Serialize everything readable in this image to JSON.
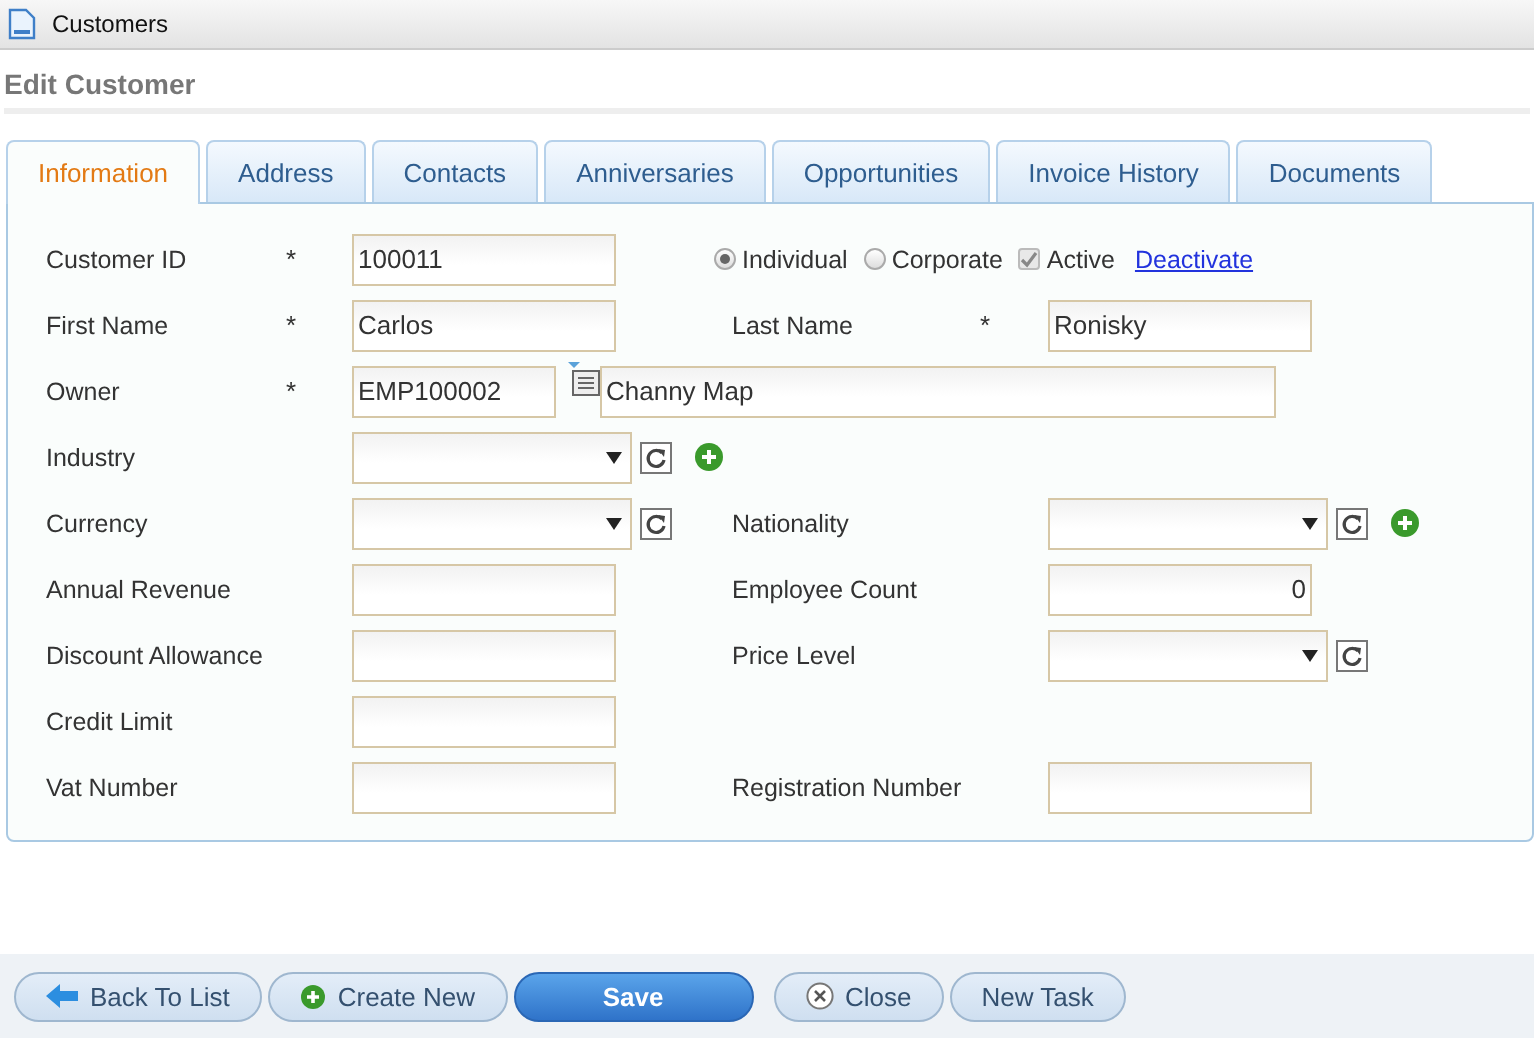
{
  "window": {
    "title": "Customers"
  },
  "heading": "Edit Customer",
  "tabs": [
    {
      "label": "Information",
      "selected": true
    },
    {
      "label": "Address",
      "selected": false
    },
    {
      "label": "Contacts",
      "selected": false
    },
    {
      "label": "Anniversaries",
      "selected": false
    },
    {
      "label": "Opportunities",
      "selected": false
    },
    {
      "label": "Invoice History",
      "selected": false
    },
    {
      "label": "Documents",
      "selected": false
    }
  ],
  "rows": [
    {
      "left": {
        "label": "Customer ID",
        "required_mark": "*",
        "kind": "text",
        "value": "100011"
      },
      "right": {
        "kind": "options",
        "radios": [
          {
            "label": "Individual",
            "selected": true
          },
          {
            "label": "Corporate",
            "selected": false
          }
        ],
        "checkbox": {
          "label": "Active",
          "checked": true,
          "disabled": true
        },
        "link": "Deactivate"
      }
    },
    {
      "left": {
        "label": "First Name",
        "required_mark": "*",
        "kind": "text",
        "value": "Carlos"
      },
      "right": {
        "label": "Last Name",
        "required_mark": "*",
        "kind": "text",
        "value": "Ronisky"
      }
    },
    {
      "left": {
        "label": "Owner",
        "required_mark": "*",
        "kind": "lookup",
        "value": "EMP100002",
        "name": "Channy Map"
      }
    },
    {
      "left": {
        "label": "Industry",
        "kind": "select",
        "actions": [
          {
            "kind": "refresh"
          },
          {
            "kind": "add"
          }
        ]
      }
    },
    {
      "left": {
        "label": "Currency",
        "kind": "select",
        "actions": [
          {
            "kind": "refresh"
          }
        ]
      },
      "right": {
        "label": "Nationality",
        "kind": "select",
        "actions": [
          {
            "kind": "refresh"
          },
          {
            "kind": "add"
          }
        ]
      }
    },
    {
      "left": {
        "label": "Annual Revenue",
        "kind": "text"
      },
      "right": {
        "label": "Employee Count",
        "kind": "number",
        "value": "0"
      }
    },
    {
      "left": {
        "label": "Discount Allowance",
        "kind": "text"
      },
      "right": {
        "label": "Price Level",
        "kind": "select",
        "actions": [
          {
            "kind": "refresh"
          }
        ]
      }
    },
    {
      "left": {
        "label": "Credit Limit",
        "kind": "text"
      }
    },
    {
      "left": {
        "label": "Vat Number",
        "kind": "text"
      },
      "right": {
        "label": "Registration Number",
        "kind": "text"
      }
    }
  ],
  "buttons": [
    {
      "label": "Back To List",
      "kind": "back"
    },
    {
      "label": "Create New",
      "kind": "add"
    },
    {
      "label": "Save",
      "kind": "primary"
    },
    {
      "label": "Close",
      "kind": "close"
    },
    {
      "label": "New Task",
      "kind": "plain"
    }
  ]
}
